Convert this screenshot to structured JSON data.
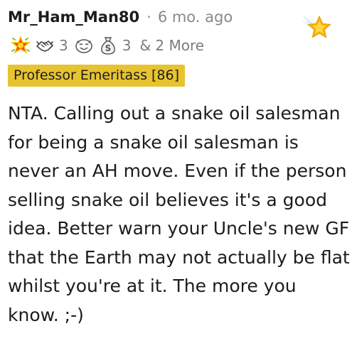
{
  "comment": {
    "username": "Mr_Ham_Man80",
    "separator": "·",
    "age": "6 mo. ago",
    "awards": [
      {
        "name": "starstruck",
        "count": ""
      },
      {
        "name": "wholesome-handshake",
        "count": "3"
      },
      {
        "name": "laughing-face",
        "count": ""
      },
      {
        "name": "money-bag",
        "count": "3"
      }
    ],
    "more_awards": "& 2 More",
    "flair": "Professor Emeritass [86]",
    "body": "NTA. Calling out a snake oil salesman for being a snake oil salesman is never an AH move. Even if the person selling snake oil believes it's a good idea. Better warn your Uncle's new GF that the Earth may not actually be flat whilst you're at it. The more you know. ;-)"
  },
  "colors": {
    "flair_background": "#e8c330",
    "muted_text": "#878a8c",
    "body_text": "#1c1c1c",
    "star_gold": "#f5b500"
  }
}
